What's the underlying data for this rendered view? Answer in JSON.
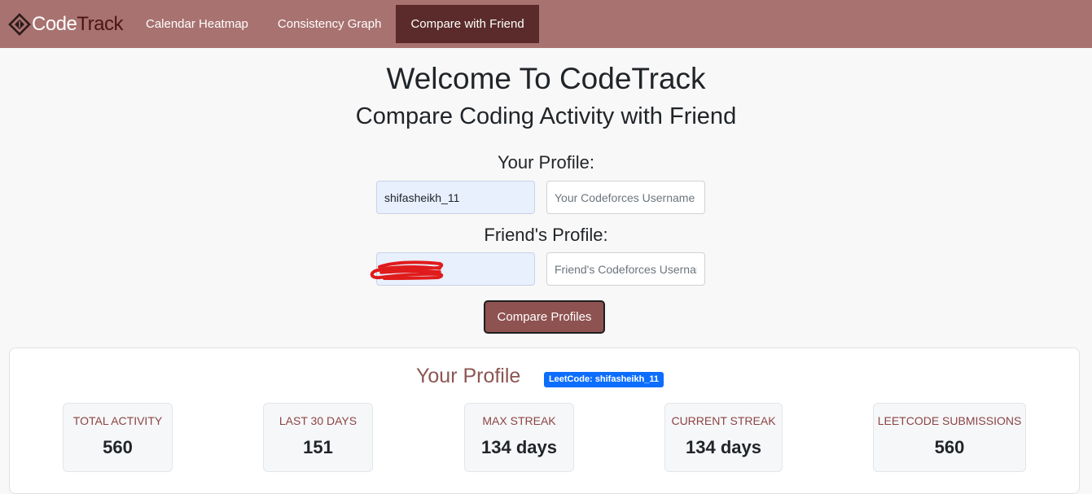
{
  "nav": {
    "brand_code": "Code",
    "brand_track": "Track",
    "items": [
      {
        "label": "Calendar Heatmap"
      },
      {
        "label": "Consistency Graph"
      },
      {
        "label": "Compare with Friend"
      }
    ]
  },
  "header": {
    "title": "Welcome To CodeTrack",
    "subtitle": "Compare Coding Activity with Friend"
  },
  "form": {
    "your_label": "Your Profile:",
    "your_leetcode_value": "shifasheikh_11",
    "your_codeforces_placeholder": "Your Codeforces Username",
    "friend_label": "Friend's Profile:",
    "friend_leetcode_value": "",
    "friend_codeforces_placeholder": "Friend's Codeforces Username",
    "compare_button": "Compare Profiles"
  },
  "profile_card": {
    "title": "Your Profile",
    "badge": "LeetCode: shifasheikh_11",
    "stats": [
      {
        "label": "Total Activity",
        "value": "560"
      },
      {
        "label": "Last 30 Days",
        "value": "151"
      },
      {
        "label": "Max Streak",
        "value": "134 days"
      },
      {
        "label": "Current Streak",
        "value": "134 days"
      },
      {
        "label": "LeetCode Submissions",
        "value": "560"
      }
    ]
  },
  "colors": {
    "navbar": "#a87270",
    "nav_active": "#5a2b2a",
    "button": "#8e5250",
    "badge": "#0d6efd",
    "scribble": "#e01b1b"
  },
  "icons": {
    "logo": "diamond-code-icon"
  }
}
